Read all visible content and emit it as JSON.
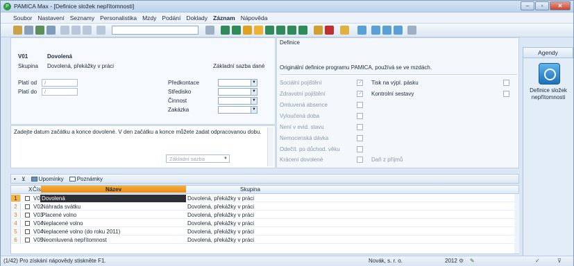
{
  "window": {
    "title": "PAMICA Max - [Definice složek nepřítomnosti]",
    "app_icon_letter": "P"
  },
  "menu": {
    "items": [
      "Soubor",
      "Nastavení",
      "Seznamy",
      "Personalistika",
      "Mzdy",
      "Podání",
      "Doklady",
      "Záznam",
      "Nápověda"
    ]
  },
  "detail": {
    "code": "V01",
    "name": "Dovolená",
    "skupina_label": "Skupina",
    "skupina_value": "Dovolená, překážky v práci",
    "zakladni_label": "Základní sazba dané",
    "plati_od_label": "Platí od",
    "plati_do_label": "Platí do",
    "date_placeholder": "/",
    "predkontace_label": "Předkontace",
    "stredisko_label": "Středisko",
    "cinnost_label": "Činnost",
    "zakazka_label": "Zakázka"
  },
  "note": {
    "text": "Zadejte datum začátku a konce dovolené. V den začátku a konce můžete zadat odpracovanou dobu."
  },
  "definice": {
    "header": "Definice",
    "description": "Originální definice programu PAMICA, používá se ve mzdách.",
    "left_items": [
      {
        "label": "Sociální pojištění",
        "checked": true
      },
      {
        "label": "Zdravotní pojištění",
        "checked": true
      },
      {
        "label": "Omluvená absence",
        "checked": false
      },
      {
        "label": "Vyloučená doba",
        "checked": false
      },
      {
        "label": "Není v evid. stavu",
        "checked": false
      },
      {
        "label": "Nemocenská dávka",
        "checked": false
      },
      {
        "label": "Odečít. po důchod. věku",
        "checked": false
      },
      {
        "label": "Krácení dovolené",
        "checked": false
      }
    ],
    "right_items": [
      {
        "label": "Tisk na výpl. pásku",
        "checked": false
      },
      {
        "label": "Kontrolní sestavy",
        "checked": false
      }
    ],
    "dan_label": "Daň z příjmů",
    "dan_select": "Základní sazba"
  },
  "agendy": {
    "header": "Agendy",
    "item_label": "Definice složek nepřítomnosti"
  },
  "tabs": [
    "Upomínky",
    "Poznámky"
  ],
  "grid": {
    "columns": {
      "x": "X",
      "cislo": "Číslo",
      "nazev": "Název",
      "skupina": "Skupina"
    },
    "rows": [
      {
        "n": "1",
        "cislo": "V01",
        "nazev": "Dovolená",
        "skupina": "Dovolená, překážky v práci",
        "selected": true
      },
      {
        "n": "2",
        "cislo": "V02",
        "nazev": "Náhrada svátku",
        "skupina": "Dovolená, překážky v práci"
      },
      {
        "n": "3",
        "cislo": "V03",
        "nazev": "Placené volno",
        "skupina": "Dovolená, překážky v práci"
      },
      {
        "n": "4",
        "cislo": "V04",
        "nazev": "Neplacené volno",
        "skupina": "Dovolená, překážky v práci"
      },
      {
        "n": "5",
        "cislo": "V04",
        "nazev": "Neplacené volno (do roku 2011)",
        "skupina": "Dovolená, překážky v práci"
      },
      {
        "n": "6",
        "cislo": "V05",
        "nazev": "Neomluvená nepřítomnost",
        "skupina": "Dovolená, překážky v práci"
      }
    ]
  },
  "status": {
    "hint": "(1/42) Pro získání nápovědy stiskněte F1.",
    "company": "Novák, s. r. o.",
    "year": "2012"
  },
  "colors": {
    "accent_orange": "#f7b13c",
    "selected_row": "#2c2f36",
    "panel_bg": "#dbe7f4"
  }
}
